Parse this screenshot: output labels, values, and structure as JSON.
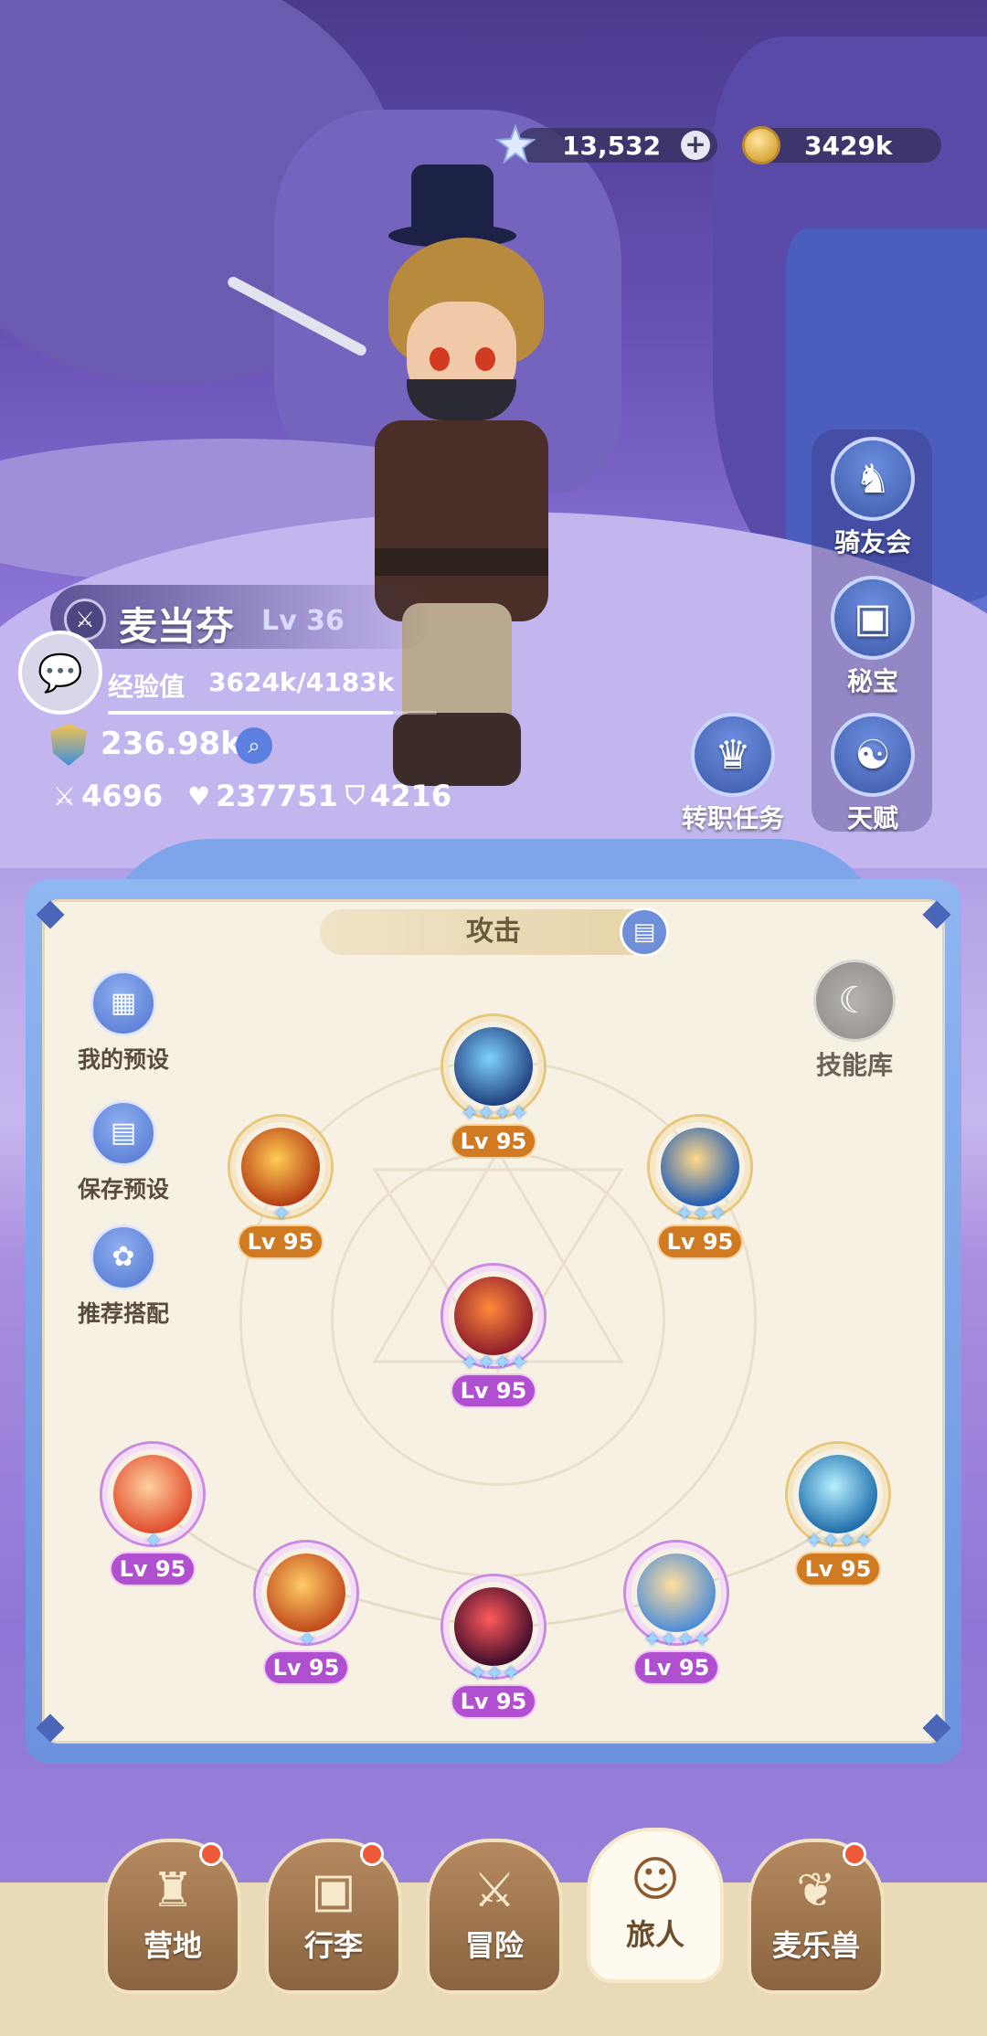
{
  "currency": {
    "gems": "13,532",
    "gold": "3429k"
  },
  "side_menu": [
    {
      "label": "骑友会",
      "icon": "horse-head-icon"
    },
    {
      "label": "秘宝",
      "icon": "treasure-chest-icon"
    },
    {
      "label": "转职任务",
      "icon": "crown-quest-icon"
    },
    {
      "label": "天赋",
      "icon": "brain-talent-icon"
    }
  ],
  "player": {
    "name": "麦当芬",
    "level": "Lv 36",
    "exp_label": "经验值",
    "exp_value": "3624k/4183k",
    "exp_fraction": 0.866,
    "power": "236.98k",
    "attack": "4696",
    "hp": "237751",
    "defense": "4216"
  },
  "panel": {
    "tab_title": "攻击",
    "left_buttons": [
      "我的预设",
      "保存预设",
      "推荐搭配"
    ],
    "library_label": "技能库"
  },
  "skills": [
    {
      "id": "top",
      "level": "Lv 95",
      "stars": 4,
      "frame": "orange",
      "art_colors": [
        "#7fd1ff",
        "#1e3d7a"
      ]
    },
    {
      "id": "left",
      "level": "Lv 95",
      "stars": 1,
      "frame": "orange",
      "art_colors": [
        "#ffcc55",
        "#b33a12"
      ]
    },
    {
      "id": "right",
      "level": "Lv 95",
      "stars": 3,
      "frame": "orange",
      "art_colors": [
        "#ffd98a",
        "#1e5bb5"
      ]
    },
    {
      "id": "center",
      "level": "Lv 95",
      "stars": 4,
      "frame": "purple",
      "art_colors": [
        "#ff8a3a",
        "#8a1a2a"
      ]
    },
    {
      "id": "row2-1",
      "level": "Lv 95",
      "stars": 1,
      "frame": "purple",
      "art_colors": [
        "#ffd0a0",
        "#e04a2a"
      ]
    },
    {
      "id": "row2-2",
      "level": "Lv 95",
      "stars": 1,
      "frame": "purple",
      "art_colors": [
        "#ffcc66",
        "#c0471a"
      ]
    },
    {
      "id": "row2-3",
      "level": "Lv 95",
      "stars": 3,
      "frame": "purple",
      "art_colors": [
        "#ff5a5a",
        "#3a0a2a"
      ]
    },
    {
      "id": "row2-4",
      "level": "Lv 95",
      "stars": 4,
      "frame": "purple",
      "art_colors": [
        "#ffe0a0",
        "#4a8ad8"
      ]
    },
    {
      "id": "row2-5",
      "level": "Lv 95",
      "stars": 4,
      "frame": "orange",
      "art_colors": [
        "#b8f0ff",
        "#1a6aa8"
      ]
    }
  ],
  "nav": [
    {
      "label": "营地",
      "icon": "castle-icon",
      "badge": true,
      "active": false
    },
    {
      "label": "行李",
      "icon": "backpack-icon",
      "badge": true,
      "active": false
    },
    {
      "label": "冒险",
      "icon": "crossed-swords-icon",
      "badge": false,
      "active": false
    },
    {
      "label": "旅人",
      "icon": "traveler-face-icon",
      "badge": false,
      "active": true
    },
    {
      "label": "麦乐兽",
      "icon": "pet-face-icon",
      "badge": true,
      "active": false
    }
  ]
}
